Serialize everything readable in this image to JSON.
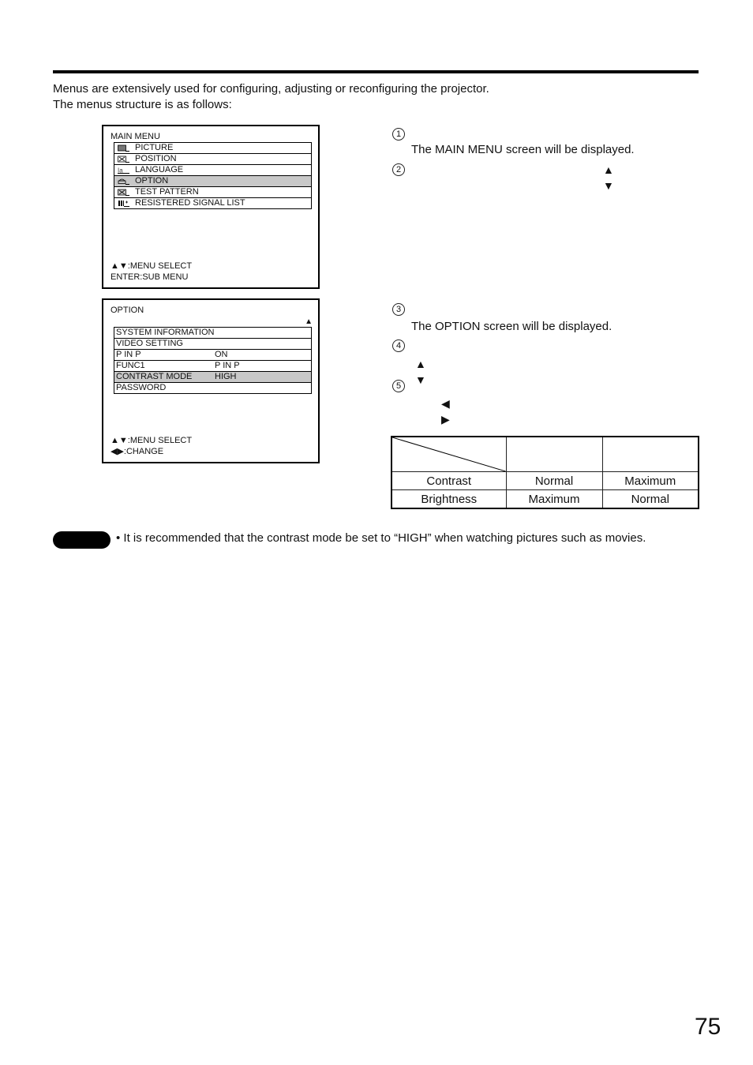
{
  "intro": {
    "line1": "Menus are extensively used for configuring, adjusting or reconfiguring the projector.",
    "line2": "The menus structure is as follows:"
  },
  "main_menu": {
    "title": "MAIN MENU",
    "items": [
      {
        "label": "PICTURE",
        "icon": "picture-icon",
        "selected": false
      },
      {
        "label": "POSITION",
        "icon": "position-icon",
        "selected": false
      },
      {
        "label": "LANGUAGE",
        "icon": "language-icon",
        "selected": false
      },
      {
        "label": "OPTION",
        "icon": "option-icon",
        "selected": true
      },
      {
        "label": "TEST PATTERN",
        "icon": "test-pattern-icon",
        "selected": false
      },
      {
        "label": "RESISTERED SIGNAL LIST",
        "icon": "signal-list-icon",
        "selected": false
      }
    ],
    "footer1": "▲▼:MENU SELECT",
    "footer2": "ENTER:SUB MENU"
  },
  "option_menu": {
    "title": "OPTION",
    "scroll_indicator": "▲",
    "items": [
      {
        "label": "SYSTEM INFORMATION",
        "value": "",
        "selected": false
      },
      {
        "label": "VIDEO SETTING",
        "value": "",
        "selected": false
      },
      {
        "label": "P IN P",
        "value": "ON",
        "selected": false
      },
      {
        "label": "FUNC1",
        "value": "P IN P",
        "selected": false
      },
      {
        "label": "CONTRAST MODE",
        "value": "HIGH",
        "selected": true
      },
      {
        "label": "PASSWORD",
        "value": "",
        "selected": false
      }
    ],
    "footer1": "▲▼:MENU SELECT",
    "footer2": "◀▶:CHANGE"
  },
  "steps": [
    {
      "num": "1",
      "text": "The MAIN MENU screen will be displayed.",
      "arrows": ""
    },
    {
      "num": "2",
      "text": "",
      "arrows": "▲ ▼"
    },
    {
      "num": "3",
      "text": "The OPTION screen will be displayed.",
      "arrows": ""
    },
    {
      "num": "4",
      "text": "",
      "arrows": "▲ ▼"
    },
    {
      "num": "5",
      "text": "",
      "arrows": "◀ ▶"
    }
  ],
  "comparison_table": {
    "header": [
      "",
      "",
      ""
    ],
    "rows": [
      [
        "Contrast",
        "Normal",
        "Maximum"
      ],
      [
        "Brightness",
        "Maximum",
        "Normal"
      ]
    ]
  },
  "note": {
    "text": "• It is recommended that the contrast mode be set to “HIGH” when watching pictures such as movies."
  },
  "page_number": "75"
}
